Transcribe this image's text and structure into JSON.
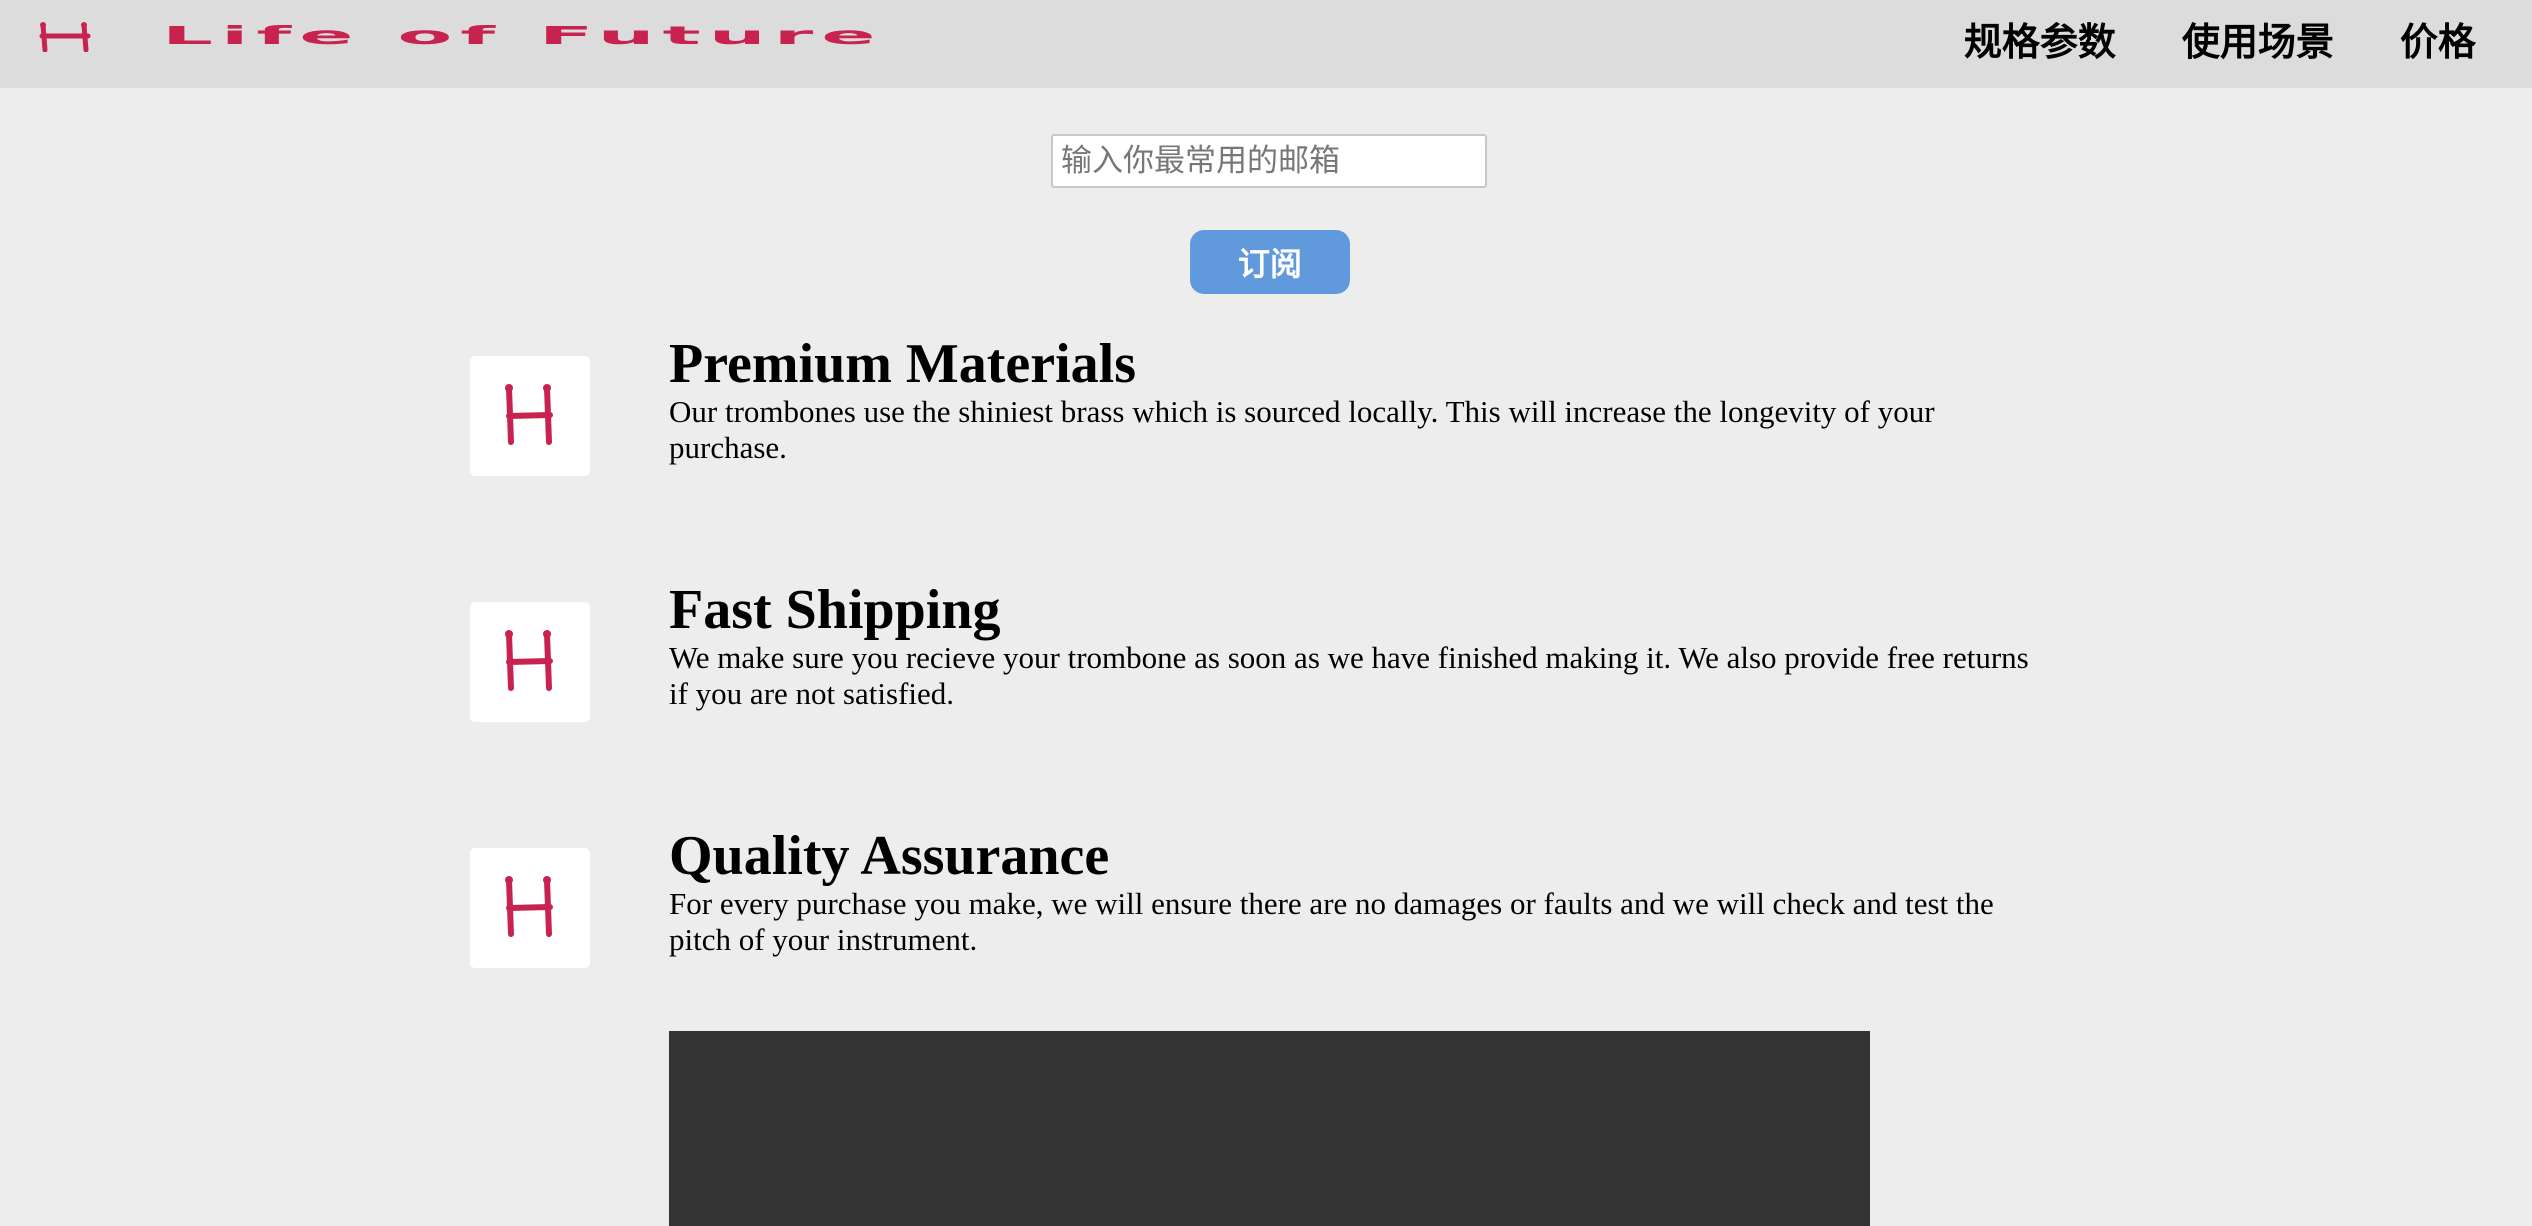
{
  "header": {
    "logo_text": "Life of Future",
    "nav": [
      {
        "label": "规格参数"
      },
      {
        "label": "使用场景"
      },
      {
        "label": "价格"
      }
    ]
  },
  "subscribe": {
    "email_placeholder": "输入你最常用的邮箱",
    "email_value": "",
    "button_label": "订阅"
  },
  "features": [
    {
      "icon": "h-logo-icon",
      "title": "Premium Materials",
      "description": "Our trombones use the shiniest brass which is sourced locally. This will increase the longevity of your purchase."
    },
    {
      "icon": "h-logo-icon",
      "title": "Fast Shipping",
      "description": "We make sure you recieve your trombone as soon as we have finished making it. We also provide free returns if you are not satisfied."
    },
    {
      "icon": "h-logo-icon",
      "title": "Quality Assurance",
      "description": "For every purchase you make, we will ensure there are no damages or faults and we will check and test the pitch of your instrument."
    }
  ],
  "colors": {
    "brand": "#c8234f",
    "header_bg": "#dcdcdc",
    "page_bg": "#ededed",
    "button_bg": "#6199dd",
    "video_bg": "#333333"
  }
}
